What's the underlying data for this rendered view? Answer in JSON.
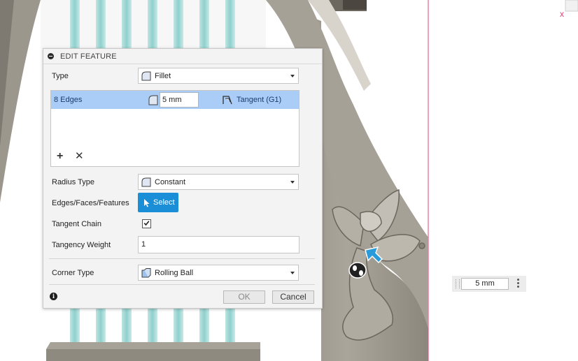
{
  "dialog": {
    "title": "EDIT FEATURE",
    "type": {
      "label": "Type",
      "value": "Fillet",
      "icon": "fillet-icon"
    },
    "edge_set": {
      "count": "8 Edges",
      "radius": "5 mm",
      "continuity": "Tangent (G1)",
      "add_label": "+",
      "remove_label": "✕"
    },
    "radius_type": {
      "label": "Radius Type",
      "value": "Constant",
      "icon": "constant-radius-icon"
    },
    "edges_faces": {
      "label": "Edges/Faces/Features",
      "button": "Select"
    },
    "tangent_chain": {
      "label": "Tangent Chain",
      "checked": true
    },
    "tangency_weight": {
      "label": "Tangency Weight",
      "value": "1"
    },
    "corner_type": {
      "label": "Corner Type",
      "value": "Rolling Ball",
      "icon": "rolling-ball-icon"
    },
    "info_label": "i",
    "ok": "OK",
    "cancel": "Cancel"
  },
  "floating_input": {
    "value": "5 mm"
  },
  "colors": {
    "selection_blue": "#a9cdf6",
    "accent_blue": "#1a8fd8",
    "model_gray": "#9c978d",
    "sketch_red": "#e0407a"
  }
}
